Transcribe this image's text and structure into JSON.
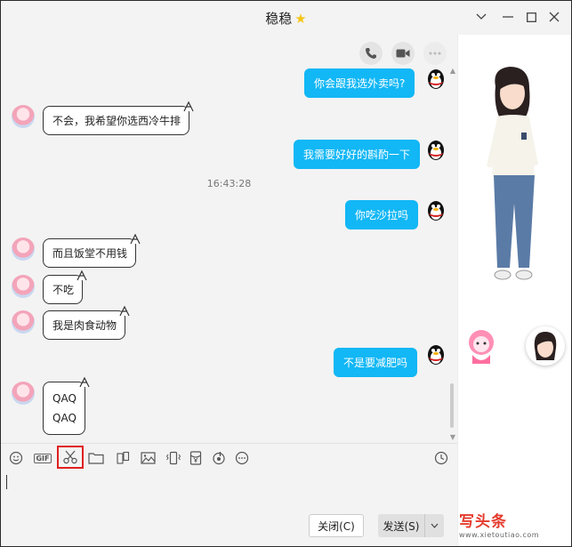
{
  "window": {
    "title": "稳稳",
    "title_star_icon": "star-icon",
    "controls": [
      "chevron-down-icon",
      "minimize-icon",
      "maximize-icon",
      "close-icon"
    ]
  },
  "chat": {
    "header_icons": [
      "phone-icon",
      "video-icon",
      "more-icon"
    ],
    "messages": [
      {
        "side": "out",
        "text": "你会跟我选外卖吗?"
      },
      {
        "side": "in",
        "text": "不会，我希望你选西冷牛排"
      },
      {
        "side": "out",
        "text": "我需要好好的斟酌一下"
      },
      {
        "type": "time",
        "text": "16:43:28"
      },
      {
        "side": "out",
        "text": "你吃沙拉吗"
      },
      {
        "side": "in",
        "text": "而且饭堂不用钱"
      },
      {
        "side": "in",
        "text": "不吃"
      },
      {
        "side": "in",
        "text": "我是肉食动物"
      },
      {
        "side": "out",
        "text": "不是要减肥吗"
      },
      {
        "side": "in",
        "lines": [
          "QAQ",
          "QAQ"
        ]
      }
    ]
  },
  "toolbar": {
    "gif_label": "GIF",
    "tools": [
      "emoji-icon",
      "gif-icon",
      "scissors-icon",
      "folder-icon",
      "screenshot-icon",
      "image-icon",
      "shake-icon",
      "redpacket-icon",
      "music-icon",
      "more-icon",
      "history-icon"
    ],
    "highlighted_tool": "scissors-icon"
  },
  "actions": {
    "close_label": "关闭(C)",
    "send_label": "发送(S)"
  },
  "watermark": {
    "main": "写头条",
    "sub": "www.xietoutiao.com"
  },
  "colors": {
    "outgoing_bubble": "#12b7f5",
    "highlight_border": "#e02020",
    "star": "#f5c518"
  }
}
